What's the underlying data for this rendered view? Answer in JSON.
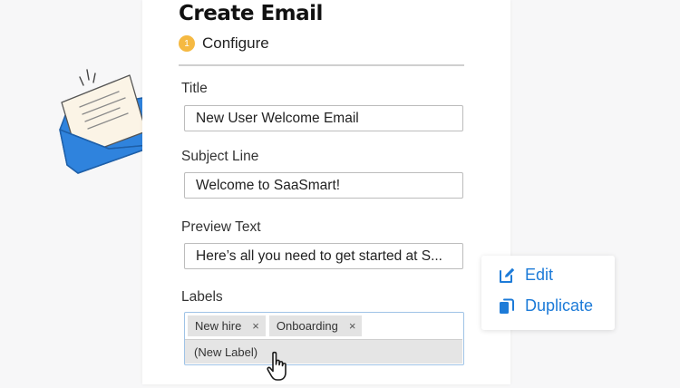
{
  "form": {
    "title": "Create Email",
    "step": {
      "number": "1",
      "label": "Configure"
    },
    "fields": {
      "title": {
        "label": "Title",
        "value": "New User Welcome Email"
      },
      "subject": {
        "label": "Subject Line",
        "value": "Welcome to SaaSmart!"
      },
      "preview": {
        "label": "Preview Text",
        "value": "Here’s all you need to get started at S..."
      },
      "labels": {
        "label": "Labels",
        "chips": [
          {
            "text": "New hire",
            "remove": "×"
          },
          {
            "text": "Onboarding",
            "remove": "×"
          }
        ],
        "new_label_option": "(New Label)"
      }
    }
  },
  "context_menu": {
    "items": [
      {
        "label": "Edit",
        "icon": "edit-icon"
      },
      {
        "label": "Duplicate",
        "icon": "duplicate-icon"
      }
    ]
  },
  "colors": {
    "accent": "#1d7bd8",
    "step_badge": "#f5b942",
    "envelope": "#2f83dd",
    "letter": "#fbf4e6"
  }
}
